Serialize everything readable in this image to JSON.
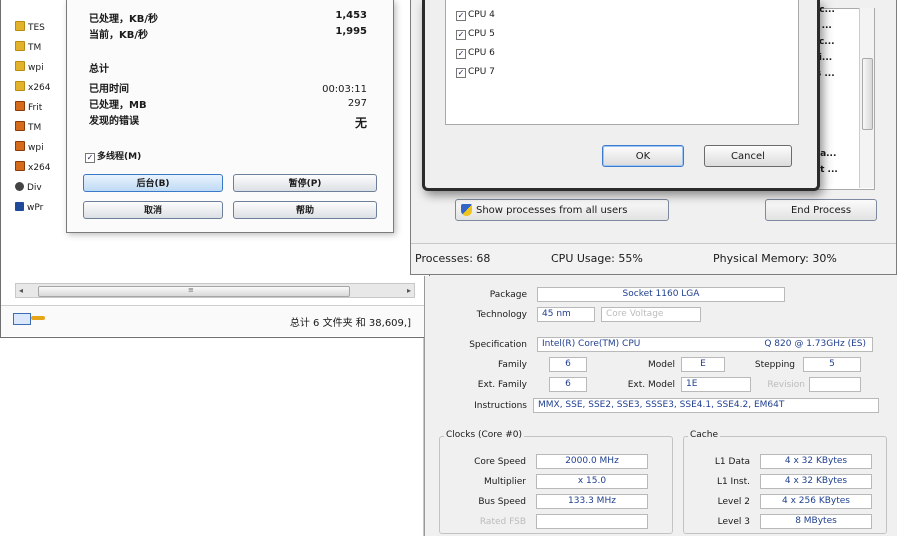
{
  "explorer": {
    "files": [
      {
        "icon": "folder-icon",
        "name": "TES"
      },
      {
        "icon": "folder-icon",
        "name": "TM"
      },
      {
        "icon": "folder-icon",
        "name": "wpi"
      },
      {
        "icon": "folder-icon",
        "name": "x264"
      },
      {
        "icon": "app-icon",
        "name": "Frit"
      },
      {
        "icon": "app-icon",
        "name": "TM"
      },
      {
        "icon": "app-icon",
        "name": "wpi"
      },
      {
        "icon": "app-icon",
        "name": "x264"
      },
      {
        "icon": "disc-icon",
        "name": "Div"
      },
      {
        "icon": "media-icon",
        "name": "wPr"
      }
    ],
    "status_text": "总计 6 文件夹 和 38,609,]"
  },
  "copy_dialog": {
    "processed_label": "已处理，KB/秒",
    "processed_value": "1,453",
    "current_label": "当前，KB/秒",
    "current_value": "1,995",
    "total_heading": "总计",
    "elapsed_label": "已用时间",
    "elapsed_value": "00:03:11",
    "processed_mb_label": "已处理，MB",
    "processed_mb_value": "297",
    "errors_label": "发现的错误",
    "errors_value": "无",
    "multithread_label": "多线程(M)",
    "multithread_checked": true,
    "background_btn": "后台(B)",
    "pause_btn": "暂停(P)",
    "cancel_btn": "取消",
    "help_btn": "帮助"
  },
  "affinity_dialog": {
    "cpus": [
      {
        "label": "CPU 4",
        "checked": true
      },
      {
        "label": "CPU 5",
        "checked": true
      },
      {
        "label": "CPU 6",
        "checked": true
      },
      {
        "label": "CPU 7",
        "checked": true
      }
    ],
    "ok_label": "OK",
    "cancel_label": "Cancel"
  },
  "task_manager": {
    "process_items": [
      "loc...",
      "is ...",
      "Mc...",
      "iLi...",
      "ys ...",
      "",
      "",
      "",
      "",
      "R a...",
      "oft ..."
    ],
    "show_all_label": "Show processes from all users",
    "end_process_label": "End Process",
    "processes": "Processes: 68",
    "cpu_usage": "CPU Usage: 55%",
    "physical_memory": "Physical Memory: 30%"
  },
  "cpuz": {
    "package_label": "Package",
    "package_value": "Socket 1160 LGA",
    "technology_label": "Technology",
    "technology_value": "45 nm",
    "core_voltage_label": "Core Voltage",
    "specification_label": "Specification",
    "specification_value": "Intel(R) Core(TM) CPU",
    "specification_extra": "Q 820  @ 1.73GHz (ES)",
    "family_label": "Family",
    "family_value": "6",
    "model_label": "Model",
    "model_value": "E",
    "stepping_label": "Stepping",
    "stepping_value": "5",
    "ext_family_label": "Ext. Family",
    "ext_family_value": "6",
    "ext_model_label": "Ext. Model",
    "ext_model_value": "1E",
    "revision_label": "Revision",
    "instructions_label": "Instructions",
    "instructions_value": "MMX, SSE, SSE2, SSE3, SSSE3, SSE4.1, SSE4.2, EM64T",
    "clocks_title": "Clocks (Core #0)",
    "core_speed_label": "Core Speed",
    "core_speed_value": "2000.0 MHz",
    "multiplier_label": "Multiplier",
    "multiplier_value": "x 15.0",
    "bus_speed_label": "Bus Speed",
    "bus_speed_value": "133.3 MHz",
    "rated_fsb_label": "Rated FSB",
    "cache_title": "Cache",
    "l1_data_label": "L1 Data",
    "l1_data_value": "4 x 32 KBytes",
    "l1_inst_label": "L1 Inst.",
    "l1_inst_value": "4 x 32 KBytes",
    "level2_label": "Level 2",
    "level2_value": "4 x 256 KBytes",
    "level3_label": "Level 3",
    "level3_value": "8 MBytes"
  }
}
